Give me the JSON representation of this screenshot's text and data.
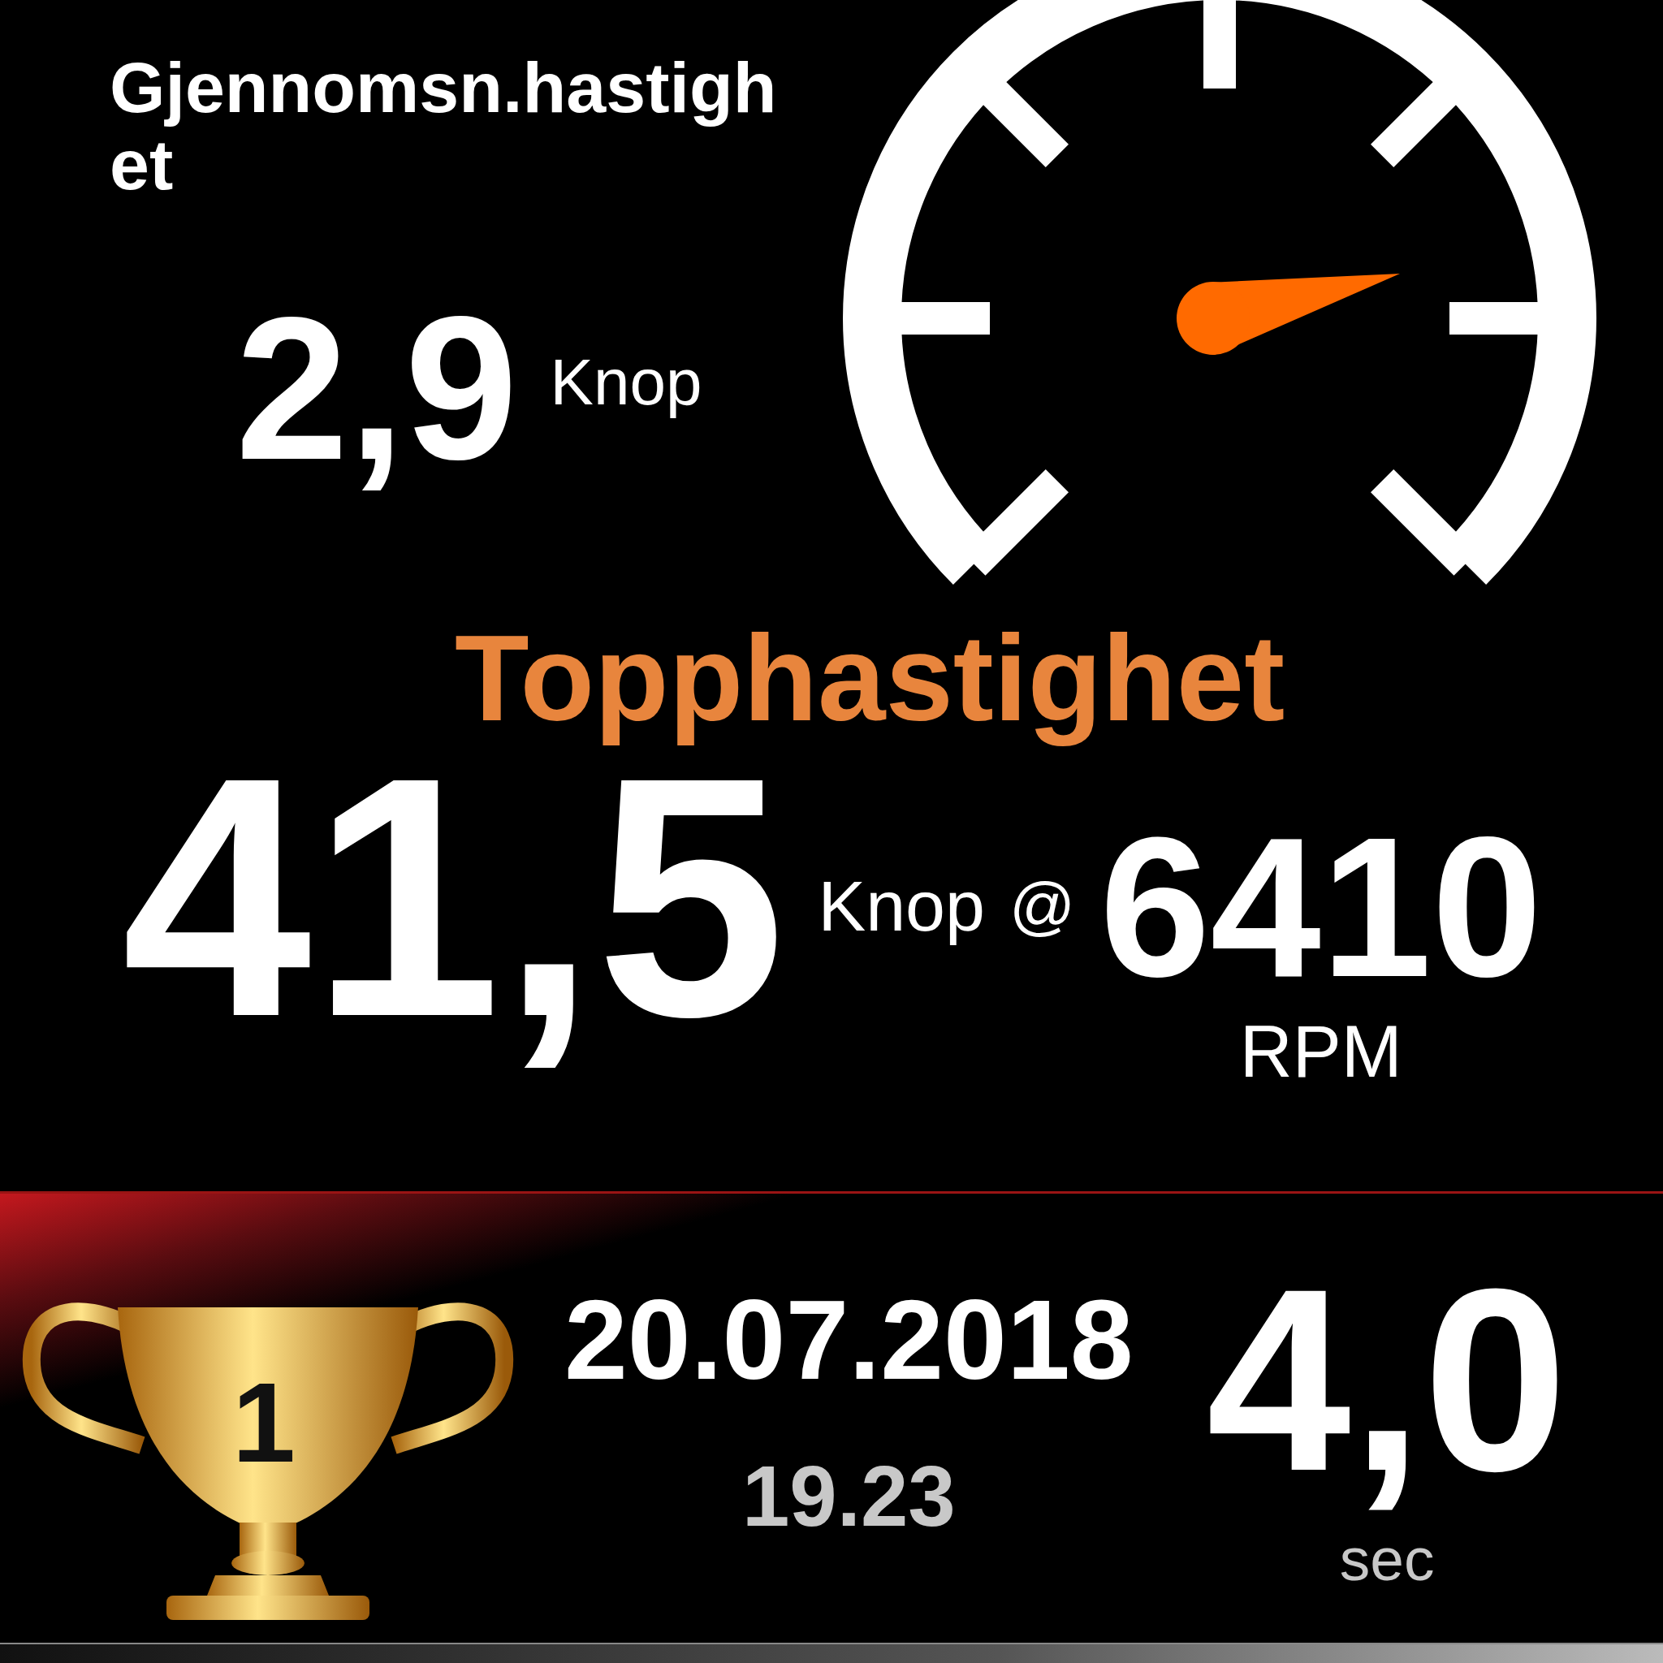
{
  "average_speed": {
    "label": "Gjennomsn.hastighet",
    "value": "2,9",
    "unit": "Knop"
  },
  "top_speed": {
    "title": "Topphastighet",
    "value": "41,5",
    "unit": "Knop",
    "at": "@",
    "rpm": "6410",
    "rpm_unit": "RPM"
  },
  "record": {
    "rank": "1",
    "date": "20.07.2018",
    "time": "19.23",
    "value": "4,0",
    "unit": "sec"
  }
}
